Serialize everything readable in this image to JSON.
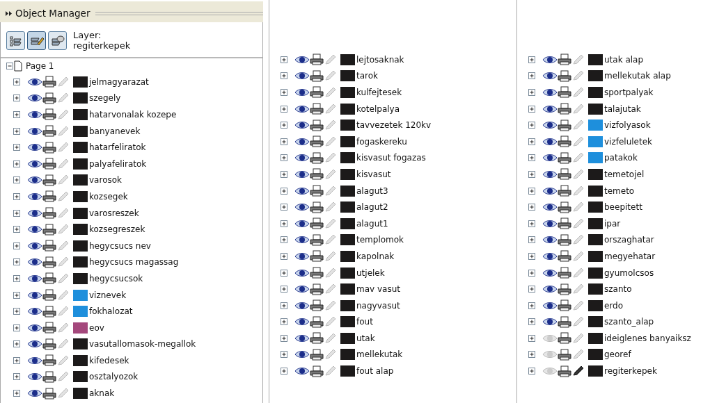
{
  "panel": {
    "title": "Object Manager"
  },
  "toolbar": {
    "buttons": [
      {
        "kind": "show-properties",
        "selected": false
      },
      {
        "kind": "edit-across-layers",
        "selected": true
      },
      {
        "kind": "layer-manager",
        "selected": false
      }
    ],
    "layer_label": "Layer:",
    "layer_name": "regiterkepek"
  },
  "page": {
    "name": "Page 1",
    "expanded": true
  },
  "columns": [
    [
      {
        "name": "jelmagyarazat",
        "visible": true,
        "editable": false,
        "color": "#1c1a1a"
      },
      {
        "name": "szegely",
        "visible": true,
        "editable": false,
        "color": "#1c1a1a"
      },
      {
        "name": "hatarvonalak kozepe",
        "visible": true,
        "editable": false,
        "color": "#1c1a1a"
      },
      {
        "name": "banyanevek",
        "visible": true,
        "editable": false,
        "color": "#1c1a1a"
      },
      {
        "name": "hatarfeliratok",
        "visible": true,
        "editable": false,
        "color": "#1c1a1a"
      },
      {
        "name": "palyafeliratok",
        "visible": true,
        "editable": false,
        "color": "#1c1a1a"
      },
      {
        "name": "varosok",
        "visible": true,
        "editable": false,
        "color": "#1c1a1a"
      },
      {
        "name": "kozsegek",
        "visible": true,
        "editable": false,
        "color": "#1c1a1a"
      },
      {
        "name": "varosreszek",
        "visible": true,
        "editable": false,
        "color": "#1c1a1a"
      },
      {
        "name": "kozsegreszek",
        "visible": true,
        "editable": false,
        "color": "#1c1a1a"
      },
      {
        "name": "hegycsucs nev",
        "visible": true,
        "editable": false,
        "color": "#1c1a1a"
      },
      {
        "name": "hegycsucs magassag",
        "visible": true,
        "editable": false,
        "color": "#1c1a1a"
      },
      {
        "name": "hegycsucsok",
        "visible": true,
        "editable": false,
        "color": "#1c1a1a"
      },
      {
        "name": "viznevek",
        "visible": true,
        "editable": false,
        "color": "#1e8fdc"
      },
      {
        "name": "fokhalozat",
        "visible": true,
        "editable": false,
        "color": "#1e8fdc"
      },
      {
        "name": "eov",
        "visible": true,
        "editable": false,
        "color": "#a4487c"
      },
      {
        "name": "vasutallomasok-megallok",
        "visible": true,
        "editable": false,
        "color": "#1c1a1a"
      },
      {
        "name": "kifedesek",
        "visible": true,
        "editable": false,
        "color": "#1c1a1a"
      },
      {
        "name": "osztalyozok",
        "visible": true,
        "editable": false,
        "color": "#1c1a1a"
      },
      {
        "name": "aknak",
        "visible": true,
        "editable": false,
        "color": "#1c1a1a"
      }
    ],
    [
      {
        "name": "lejtosaknak",
        "visible": true,
        "editable": false,
        "color": "#1c1a1a"
      },
      {
        "name": "tarok",
        "visible": true,
        "editable": false,
        "color": "#1c1a1a"
      },
      {
        "name": "kulfejtesek",
        "visible": true,
        "editable": false,
        "color": "#1c1a1a"
      },
      {
        "name": "kotelpalya",
        "visible": true,
        "editable": false,
        "color": "#1c1a1a"
      },
      {
        "name": "tavvezetek 120kv",
        "visible": true,
        "editable": false,
        "color": "#1c1a1a"
      },
      {
        "name": "fogaskereku",
        "visible": true,
        "editable": false,
        "color": "#1c1a1a"
      },
      {
        "name": "kisvasut fogazas",
        "visible": true,
        "editable": false,
        "color": "#1c1a1a"
      },
      {
        "name": "kisvasut",
        "visible": true,
        "editable": false,
        "color": "#1c1a1a"
      },
      {
        "name": "alagut3",
        "visible": true,
        "editable": false,
        "color": "#1c1a1a"
      },
      {
        "name": "alagut2",
        "visible": true,
        "editable": false,
        "color": "#1c1a1a"
      },
      {
        "name": "alagut1",
        "visible": true,
        "editable": false,
        "color": "#1c1a1a"
      },
      {
        "name": "templomok",
        "visible": true,
        "editable": false,
        "color": "#1c1a1a"
      },
      {
        "name": "kapolnak",
        "visible": true,
        "editable": false,
        "color": "#1c1a1a"
      },
      {
        "name": "utjelek",
        "visible": true,
        "editable": false,
        "color": "#1c1a1a"
      },
      {
        "name": "mav vasut",
        "visible": true,
        "editable": false,
        "color": "#1c1a1a"
      },
      {
        "name": "nagyvasut",
        "visible": true,
        "editable": false,
        "color": "#1c1a1a"
      },
      {
        "name": "fout",
        "visible": true,
        "editable": false,
        "color": "#1c1a1a"
      },
      {
        "name": "utak",
        "visible": true,
        "editable": false,
        "color": "#1c1a1a"
      },
      {
        "name": "mellekutak",
        "visible": true,
        "editable": false,
        "color": "#1c1a1a"
      },
      {
        "name": "fout alap",
        "visible": true,
        "editable": false,
        "color": "#1c1a1a"
      }
    ],
    [
      {
        "name": "utak alap",
        "visible": true,
        "editable": false,
        "color": "#1c1a1a"
      },
      {
        "name": "mellekutak alap",
        "visible": true,
        "editable": false,
        "color": "#1c1a1a"
      },
      {
        "name": "sportpalyak",
        "visible": true,
        "editable": false,
        "color": "#1c1a1a"
      },
      {
        "name": "talajutak",
        "visible": true,
        "editable": false,
        "color": "#1c1a1a"
      },
      {
        "name": "vizfolyasok",
        "visible": true,
        "editable": false,
        "color": "#1e8fdc"
      },
      {
        "name": "vizfeluletek",
        "visible": true,
        "editable": false,
        "color": "#1e8fdc"
      },
      {
        "name": "patakok",
        "visible": true,
        "editable": false,
        "color": "#1e8fdc"
      },
      {
        "name": "temetojel",
        "visible": true,
        "editable": false,
        "color": "#1c1a1a"
      },
      {
        "name": "temeto",
        "visible": true,
        "editable": false,
        "color": "#1c1a1a"
      },
      {
        "name": "beepitett",
        "visible": true,
        "editable": false,
        "color": "#1c1a1a"
      },
      {
        "name": "ipar",
        "visible": true,
        "editable": false,
        "color": "#1c1a1a"
      },
      {
        "name": "orszaghatar",
        "visible": true,
        "editable": false,
        "color": "#1c1a1a"
      },
      {
        "name": "megyehatar",
        "visible": true,
        "editable": false,
        "color": "#1c1a1a"
      },
      {
        "name": "gyumolcsos",
        "visible": true,
        "editable": false,
        "color": "#1c1a1a"
      },
      {
        "name": "szanto",
        "visible": true,
        "editable": false,
        "color": "#1c1a1a"
      },
      {
        "name": "erdo",
        "visible": true,
        "editable": false,
        "color": "#1c1a1a"
      },
      {
        "name": "szanto_alap",
        "visible": true,
        "editable": false,
        "color": "#1c1a1a"
      },
      {
        "name": "ideiglenes banyaiksz",
        "visible": false,
        "editable": false,
        "color": "#1c1a1a"
      },
      {
        "name": "georef",
        "visible": false,
        "editable": false,
        "color": "#1c1a1a"
      },
      {
        "name": "regiterkepek",
        "visible": false,
        "editable": true,
        "color": "#1c1a1a"
      }
    ]
  ]
}
